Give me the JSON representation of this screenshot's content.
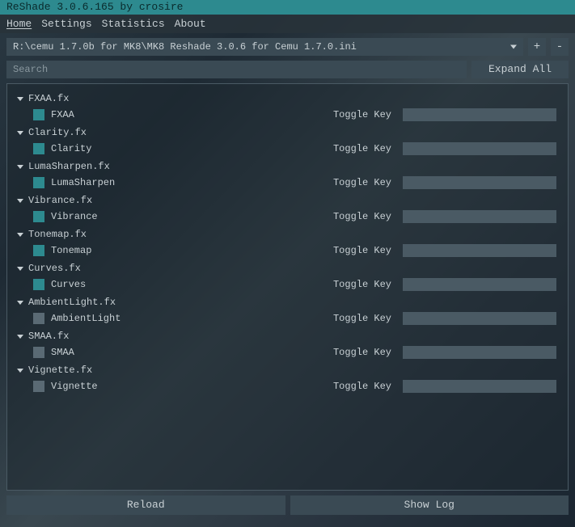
{
  "title": "ReShade 3.0.6.165 by crosire",
  "menu": {
    "items": [
      "Home",
      "Settings",
      "Statistics",
      "About"
    ],
    "activeIndex": 0
  },
  "preset": {
    "path": "R:\\cemu 1.7.0b for MK8\\MK8 Reshade 3.0.6 for Cemu 1.7.0.ini",
    "plus": "+",
    "minus": "-"
  },
  "search": {
    "placeholder": "Search",
    "value": ""
  },
  "expand_label": "Expand All",
  "toggle_key_label": "Toggle Key",
  "effects": [
    {
      "file": "FXAA.fx",
      "items": [
        {
          "name": "FXAA",
          "checked": true
        }
      ]
    },
    {
      "file": "Clarity.fx",
      "items": [
        {
          "name": "Clarity",
          "checked": true
        }
      ]
    },
    {
      "file": "LumaSharpen.fx",
      "items": [
        {
          "name": "LumaSharpen",
          "checked": true
        }
      ]
    },
    {
      "file": "Vibrance.fx",
      "items": [
        {
          "name": "Vibrance",
          "checked": true
        }
      ]
    },
    {
      "file": "Tonemap.fx",
      "items": [
        {
          "name": "Tonemap",
          "checked": true
        }
      ]
    },
    {
      "file": "Curves.fx",
      "items": [
        {
          "name": "Curves",
          "checked": true
        }
      ]
    },
    {
      "file": "AmbientLight.fx",
      "items": [
        {
          "name": "AmbientLight",
          "checked": false
        }
      ]
    },
    {
      "file": "SMAA.fx",
      "items": [
        {
          "name": "SMAA",
          "checked": false
        }
      ]
    },
    {
      "file": "Vignette.fx",
      "items": [
        {
          "name": "Vignette",
          "checked": false
        }
      ]
    }
  ],
  "buttons": {
    "reload": "Reload",
    "showlog": "Show Log"
  }
}
